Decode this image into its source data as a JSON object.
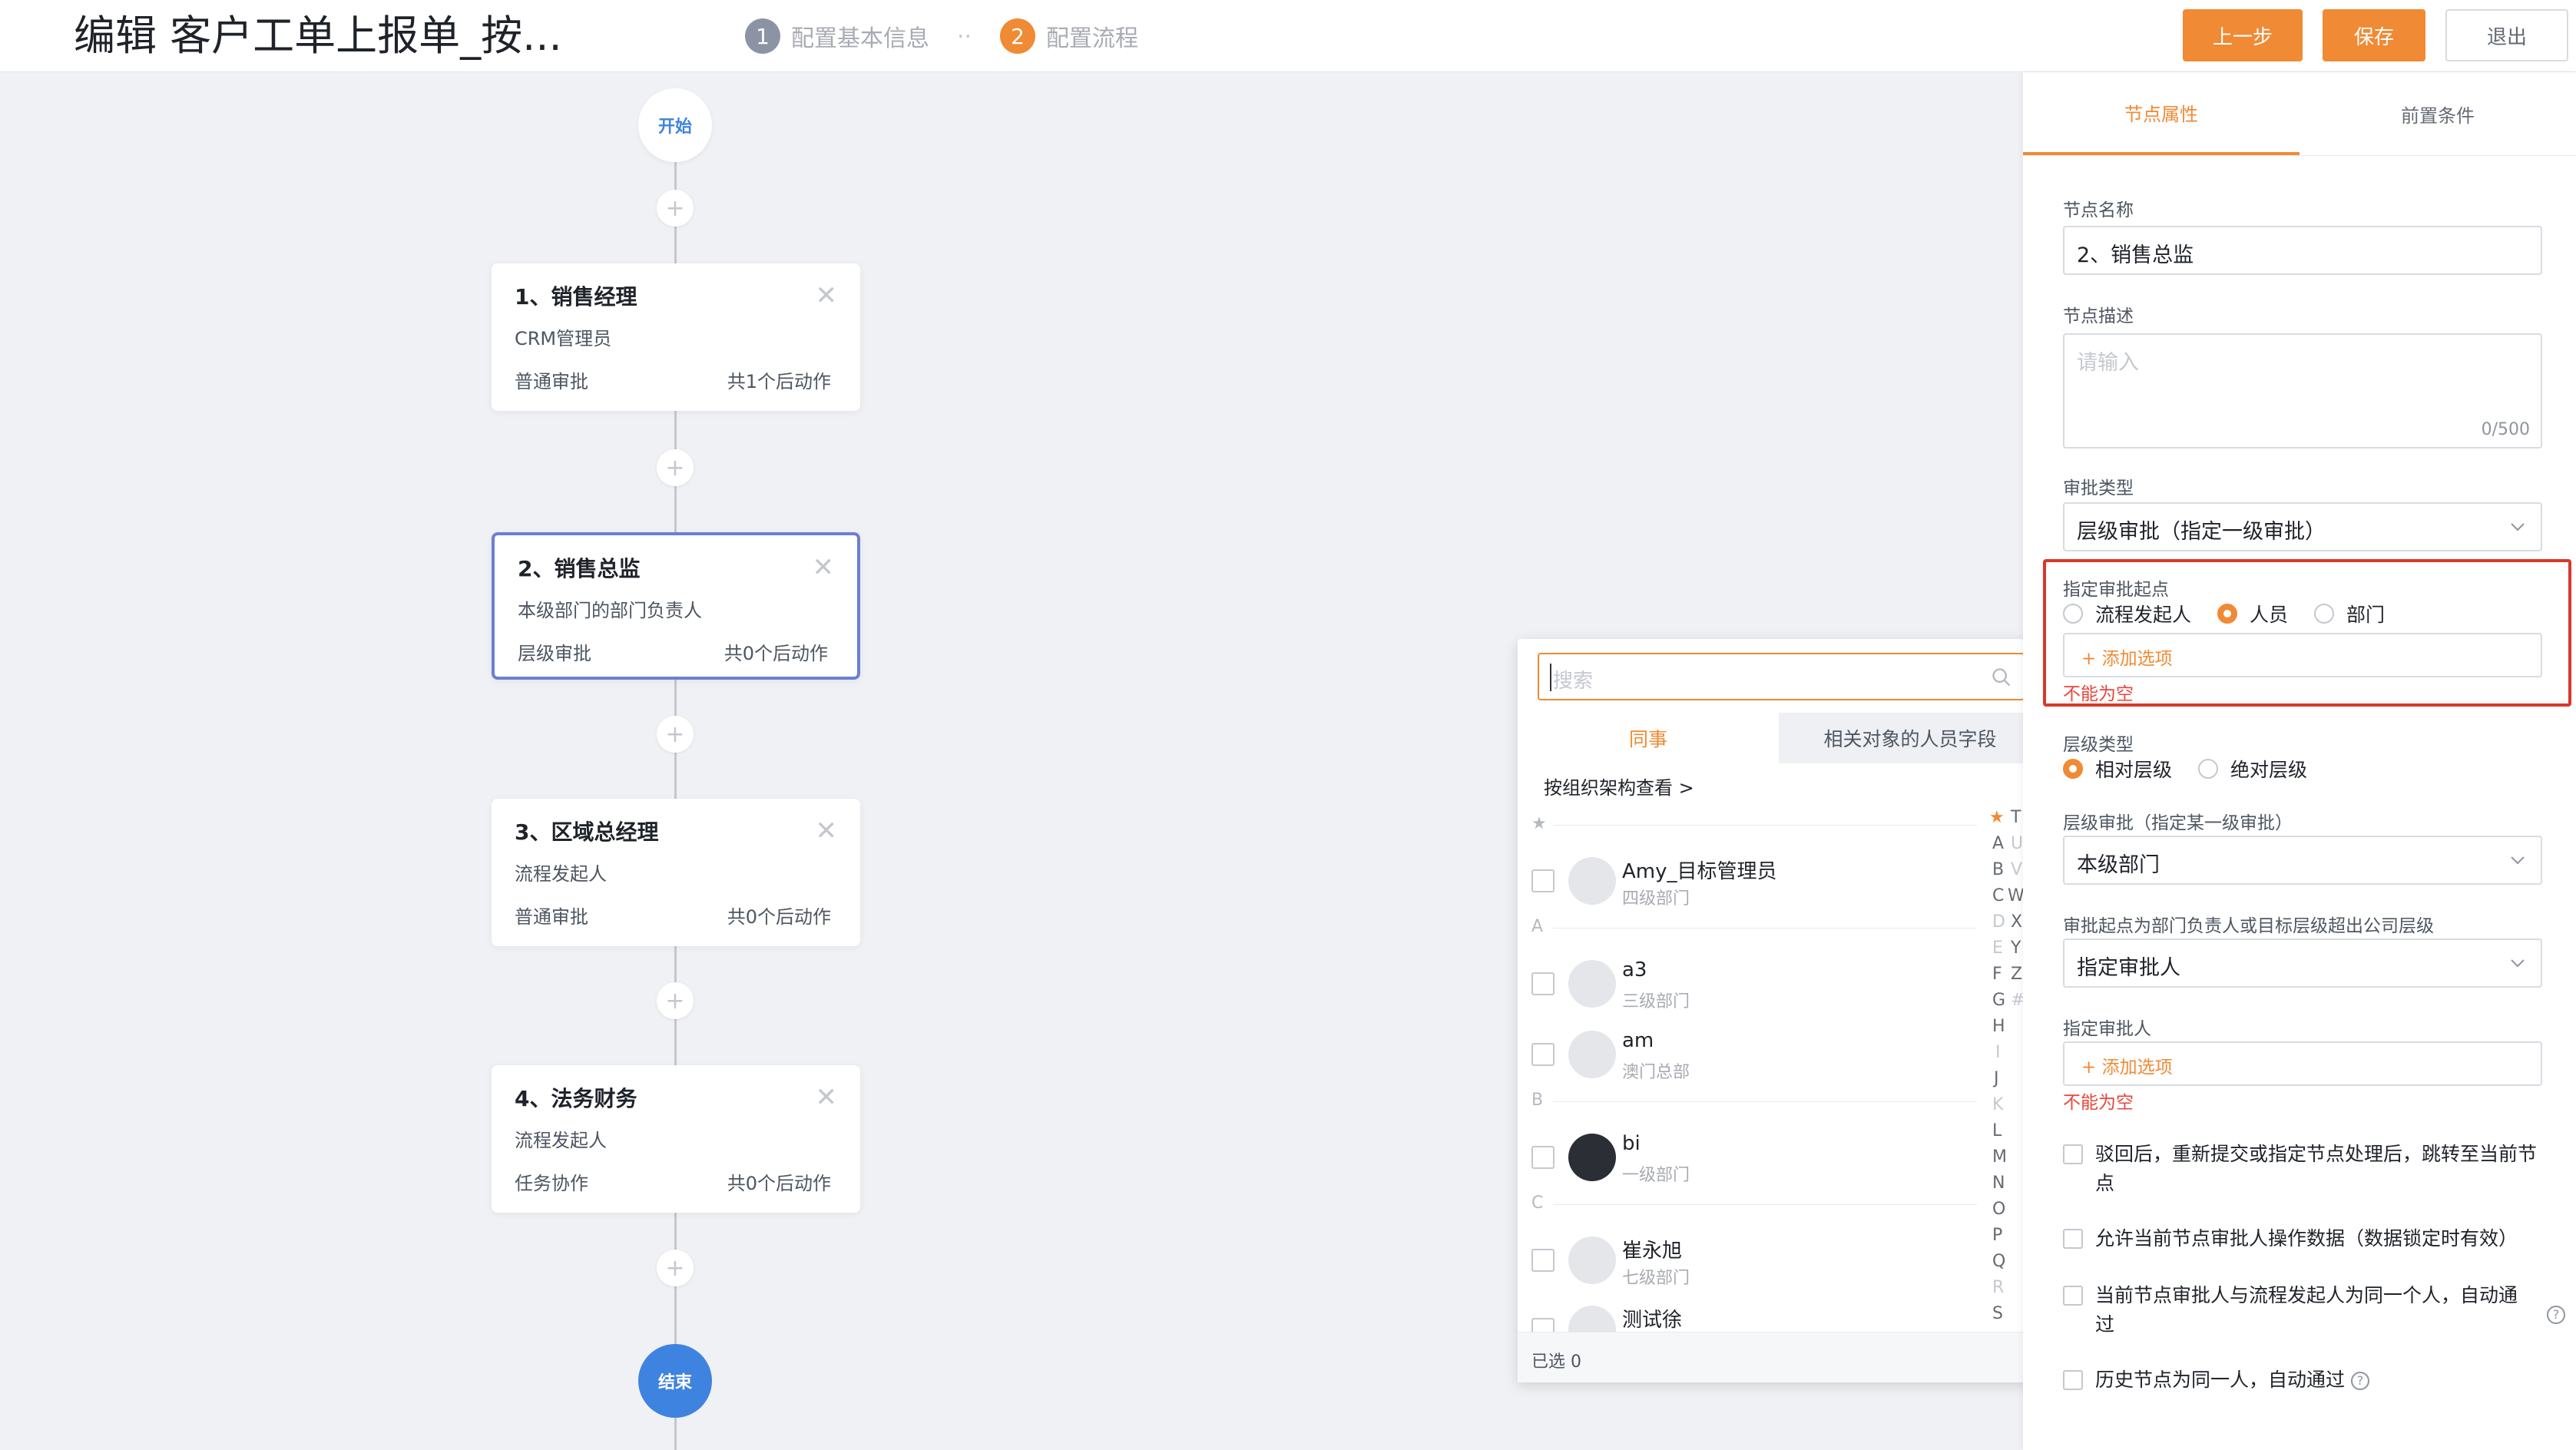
{
  "header": {
    "title": "编辑 客户工单上报单_按...",
    "steps": [
      {
        "num": "1",
        "label": "配置基本信息"
      },
      {
        "num": "2",
        "label": "配置流程"
      }
    ],
    "separator": "..",
    "buttons": {
      "prev": "上一步",
      "save": "保存",
      "exit": "退出"
    }
  },
  "flow": {
    "start": "开始",
    "end": "结束",
    "plus": "+",
    "nodes": [
      {
        "title": "1、销售经理",
        "subtitle": "CRM管理员",
        "type": "普通审批",
        "count": "共1个后动作"
      },
      {
        "title": "2、销售总监",
        "subtitle": "本级部门的部门负责人",
        "type": "层级审批",
        "count": "共0个后动作"
      },
      {
        "title": "3、区域总经理",
        "subtitle": "流程发起人",
        "type": "普通审批",
        "count": "共0个后动作"
      },
      {
        "title": "4、法务财务",
        "subtitle": "流程发起人",
        "type": "任务协作",
        "count": "共0个后动作"
      }
    ]
  },
  "picker": {
    "search_placeholder": "搜索",
    "tabs": [
      "同事",
      "相关对象的人员字段"
    ],
    "org_link": "按组织架构查看 >",
    "groups": {
      "star": "★",
      "a": "A",
      "b": "B",
      "c": "C"
    },
    "people": [
      {
        "name": "Amy_目标管理员",
        "dept": "四级部门"
      },
      {
        "name": "a3",
        "dept": "三级部门"
      },
      {
        "name": "am",
        "dept": "澳门总部"
      },
      {
        "name": "bi",
        "dept": "一级部门"
      },
      {
        "name": "崔永旭",
        "dept": "七级部门"
      },
      {
        "name": "测试徐",
        "dept": ""
      }
    ],
    "index_left": [
      "★",
      "A",
      "B",
      "C",
      "D",
      "E",
      "F",
      "G",
      "H",
      "I",
      "J",
      "K",
      "L",
      "M",
      "N",
      "O",
      "P",
      "Q",
      "R",
      "S"
    ],
    "index_right": [
      "T",
      "U",
      "V",
      "W",
      "X",
      "Y",
      "Z",
      "#"
    ],
    "selected": "已选 0"
  },
  "panel": {
    "tabs": {
      "props": "节点属性",
      "pre": "前置条件"
    },
    "node_name_label": "节点名称",
    "node_name_value": "2、销售总监",
    "node_desc_label": "节点描述",
    "node_desc_placeholder": "请输入",
    "node_desc_count": "0/500",
    "approval_type_label": "审批类型",
    "approval_type_value": "层级审批（指定一级审批）",
    "start_point_label": "指定审批起点",
    "start_point_options": [
      "流程发起人",
      "人员",
      "部门"
    ],
    "add_option": "+ 添加选项",
    "not_empty": "不能为空",
    "level_type_label": "层级类型",
    "level_type_options": [
      "相对层级",
      "绝对层级"
    ],
    "level_approval_label": "层级审批（指定某一级审批）",
    "level_approval_value": "本级部门",
    "overflow_label": "审批起点为部门负责人或目标层级超出公司层级",
    "overflow_value": "指定审批人",
    "assignee_label": "指定审批人",
    "checks": [
      "驳回后，重新提交或指定节点处理后，跳转至当前节点",
      "允许当前节点审批人操作数据（数据锁定时有效）",
      "当前节点审批人与流程发起人为同一个人，自动通过",
      "历史节点为同一人，自动通过"
    ],
    "help": "?"
  },
  "colors": {
    "accent": "#f08a34",
    "blue": "#3f83e0",
    "error": "#e8463b",
    "selected_border": "#6b7fd4"
  }
}
